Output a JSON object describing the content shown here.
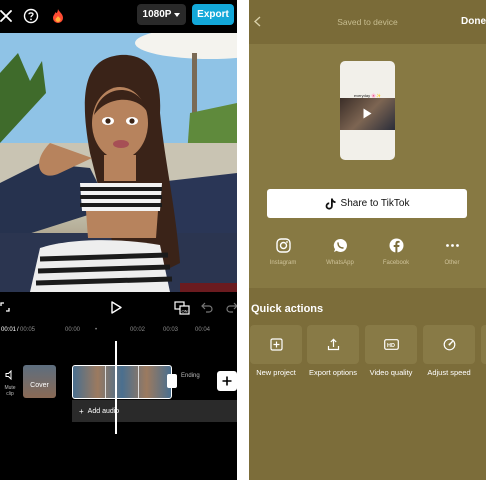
{
  "editor": {
    "resolution": "1080P",
    "export_label": "Export",
    "time_current": "00:01",
    "time_total": "00:05",
    "ruler_ticks": [
      "00:00",
      "00:02",
      "00:03",
      "00:04"
    ],
    "mute_label": "Mute clip",
    "cover_label": "Cover",
    "ending_label": "Ending",
    "add_audio_label": "Add audio"
  },
  "done": {
    "title": "Saved to device",
    "done_label": "Done",
    "thumb_caption": "everyday 🌸✨",
    "tiktok_label": "Share to TikTok",
    "share_targets": [
      {
        "label": "Instagram",
        "icon": "instagram-icon"
      },
      {
        "label": "WhatsApp",
        "icon": "whatsapp-icon"
      },
      {
        "label": "Facebook",
        "icon": "facebook-icon"
      },
      {
        "label": "Other",
        "icon": "more-icon"
      }
    ],
    "quick_actions_title": "Quick actions",
    "quick_actions": [
      {
        "label": "New project",
        "icon": "add-icon"
      },
      {
        "label": "Export options",
        "icon": "export-icon"
      },
      {
        "label": "Video quality",
        "icon": "hd-icon"
      },
      {
        "label": "Adjust speed",
        "icon": "speed-icon"
      }
    ]
  },
  "colors": {
    "accent": "#13a8d9",
    "panel_bg": "#7c6d3a",
    "card_bg": "#877943"
  }
}
